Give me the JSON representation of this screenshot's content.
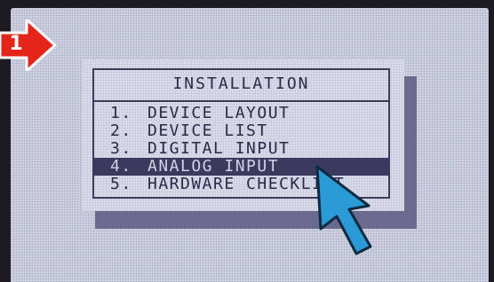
{
  "step_marker": {
    "label": "1",
    "color": "#e32619"
  },
  "menu": {
    "title": "INSTALLATION",
    "selected_index": 3,
    "items": [
      {
        "number": "1.",
        "label": "DEVICE LAYOUT"
      },
      {
        "number": "2.",
        "label": "DEVICE LIST"
      },
      {
        "number": "3.",
        "label": "DIGITAL INPUT"
      },
      {
        "number": "4.",
        "label": "ANALOG INPUT"
      },
      {
        "number": "5.",
        "label": "HARDWARE CHECKLIST"
      }
    ]
  },
  "colors": {
    "lcd_background": "#cfd2e3",
    "lcd_text": "#2a2a48",
    "highlight": "#3a3a5e",
    "panel_shadow": "#6a6a8e",
    "pointer": "#2a9bd6"
  },
  "icons": {
    "step_marker": "red-arrow-icon",
    "pointer": "cursor-arrow-icon"
  }
}
